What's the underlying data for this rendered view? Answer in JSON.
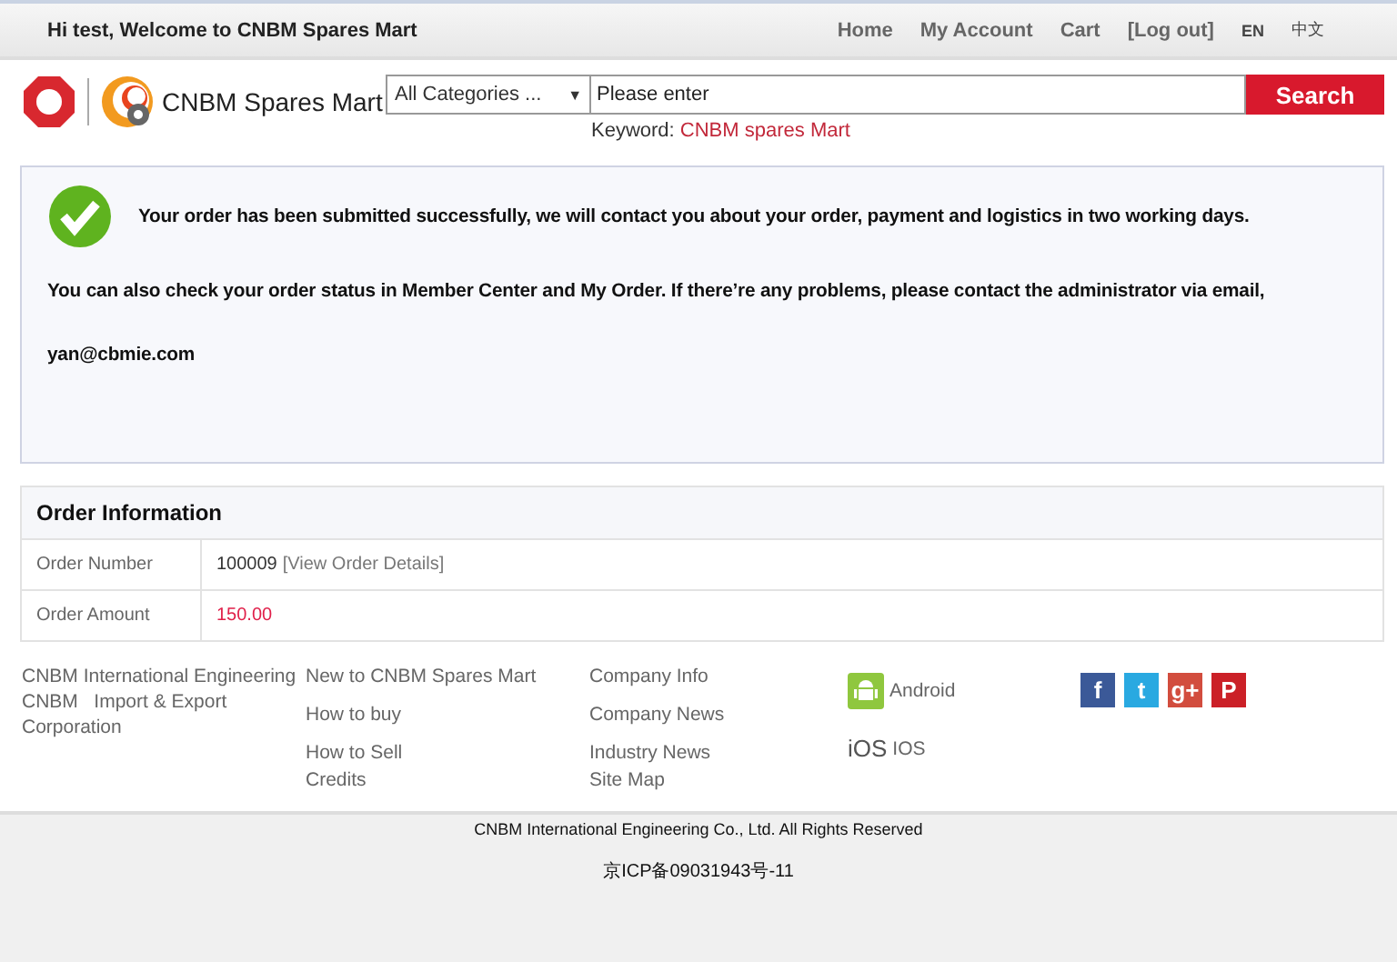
{
  "topbar": {
    "welcome": "Hi test, Welcome to CNBM Spares Mart",
    "links": [
      "Home",
      "My Account",
      "Cart",
      "[Log out]"
    ],
    "languages": [
      {
        "label": "EN",
        "selected": true
      },
      {
        "label": "中文",
        "selected": false
      }
    ]
  },
  "header": {
    "brand": "CNBM Spares Mart",
    "category": "All Categories ...",
    "caret": "▼",
    "search_placeholder": "Please enter",
    "search_button": "Search",
    "keyword_label": "Keyword:",
    "keyword": "CNBM spares Mart"
  },
  "notice": {
    "headline": "Your order has been submitted successfully, we will contact you about your order, payment and logistics in two working days.",
    "body": "You can also check your order status in Member Center and My Order. If there’re any problems, please contact the administrator via email,",
    "email": "yan@cbmie.com"
  },
  "order": {
    "title": "Order Information",
    "rows": [
      {
        "kind": "number",
        "label": "Order Number",
        "value": "100009",
        "link": "[View Order Details]"
      },
      {
        "kind": "amount",
        "label": "Order Amount",
        "value": "150.00"
      }
    ]
  },
  "footer": {
    "company": "CNBM International Engineering\nCNBM   Import & Export\nCorporation",
    "columns": [
      [
        "New to CNBM Spares Mart",
        "How to buy",
        [
          "How to Sell",
          "Credits"
        ]
      ],
      [
        "Company Info",
        "Company News",
        [
          "Industry News",
          "Site Map"
        ]
      ]
    ],
    "apps": [
      {
        "kind": "android",
        "label": "Android"
      },
      {
        "kind": "ios",
        "logo": "iOS",
        "label": "IOS"
      }
    ],
    "social": [
      {
        "glyph": "f",
        "color": "#3b5998"
      },
      {
        "glyph": "t",
        "color": "#29a9e1"
      },
      {
        "glyph": "g+",
        "color": "#d24d3e"
      },
      {
        "glyph": "P",
        "color": "#cb2027"
      }
    ],
    "copyright": "CNBM International Engineering Co., Ltd. All Rights Reserved",
    "icp": "京ICP备09031943号-11"
  }
}
